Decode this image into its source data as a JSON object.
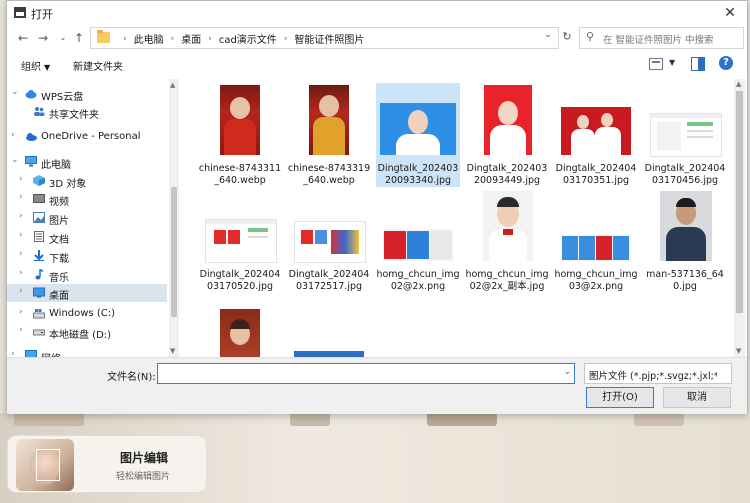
{
  "background": {
    "card_title": "图片编辑",
    "card_subtitle": "轻松编辑图片"
  },
  "dialog": {
    "title": "打开"
  },
  "address": {
    "crumbs": [
      "此电脑",
      "桌面",
      "cad演示文件",
      "智能证件照图片"
    ]
  },
  "search": {
    "placeholder": "在 智能证件照图片 中搜索"
  },
  "toolbar": {
    "organize_label": "组织",
    "new_folder_label": "新建文件夹"
  },
  "nav": {
    "items": [
      {
        "label": "WPS云盘",
        "icon": "cloud-icon"
      },
      {
        "label": "共享文件夹",
        "icon": "shared-users-icon"
      },
      {
        "label": "OneDrive - Personal",
        "icon": "onedrive-icon"
      },
      {
        "label": "此电脑",
        "icon": "computer-icon"
      },
      {
        "label": "3D 对象",
        "icon": "3d-objects-icon"
      },
      {
        "label": "视频",
        "icon": "video-icon"
      },
      {
        "label": "图片",
        "icon": "pictures-icon"
      },
      {
        "label": "文档",
        "icon": "documents-icon"
      },
      {
        "label": "下载",
        "icon": "download-icon"
      },
      {
        "label": "音乐",
        "icon": "music-icon"
      },
      {
        "label": "桌面",
        "icon": "desktop-icon"
      },
      {
        "label": "Windows (C:)",
        "icon": "drive-c-icon"
      },
      {
        "label": "本地磁盘 (D:)",
        "icon": "drive-d-icon"
      },
      {
        "label": "网络",
        "icon": "network-icon"
      }
    ]
  },
  "files": [
    {
      "name": "chinese-8743311_640.webp"
    },
    {
      "name": "chinese-8743319_640.webp"
    },
    {
      "name": "Dingtalk_20240320093340.jpg"
    },
    {
      "name": "Dingtalk_20240320093449.jpg"
    },
    {
      "name": "Dingtalk_20240403170351.jpg"
    },
    {
      "name": "Dingtalk_20240403170456.jpg"
    },
    {
      "name": "Dingtalk_20240403170520.jpg"
    },
    {
      "name": "Dingtalk_20240403172517.jpg"
    },
    {
      "name": "homg_chcun_img02@2x.png"
    },
    {
      "name": "homg_chcun_img02@2x_副本.jpg"
    },
    {
      "name": "homg_chcun_img03@2x.png"
    },
    {
      "name": "man-537136_640.jpg"
    },
    {
      "name": ""
    },
    {
      "name": ""
    }
  ],
  "footer": {
    "filename_label": "文件名(N):",
    "filename_value": "",
    "filetype_label": "图片文件 (*.pjp;*.svgz;*.jxl;*.jp",
    "open_label": "打开(O)",
    "cancel_label": "取消"
  }
}
